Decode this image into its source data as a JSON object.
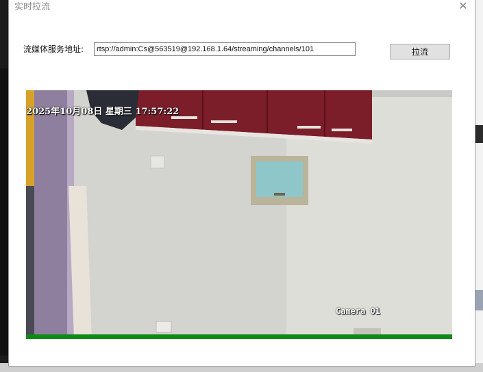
{
  "window": {
    "title": "实时拉流",
    "close_glyph": "✕"
  },
  "stream": {
    "label": "流媒体服务地址:",
    "url": "rtsp://admin:Cs@563519@192.168.1.64/streaming/channels/101"
  },
  "toolbar": {
    "pull_label": "拉流"
  },
  "video": {
    "timestamp": "2025年10月08日 星期三 17:57:22",
    "camera_name": "Camera 01",
    "status_color": "#0f8a18"
  }
}
